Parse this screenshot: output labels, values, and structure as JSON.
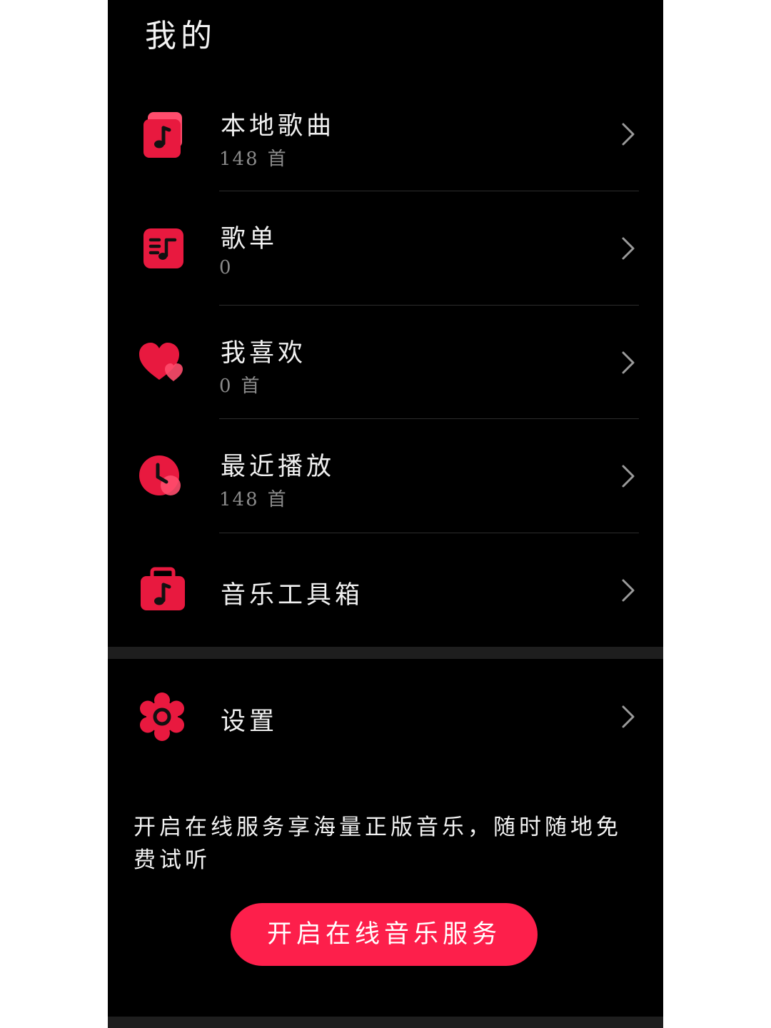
{
  "header": {
    "title": "我的"
  },
  "menu": {
    "items": [
      {
        "id": "local-songs",
        "title": "本地歌曲",
        "count": "148",
        "unit": "首",
        "icon": "music-note-icon"
      },
      {
        "id": "playlists",
        "title": "歌单",
        "count": "0",
        "unit": "",
        "icon": "playlist-icon"
      },
      {
        "id": "favorites",
        "title": "我喜欢",
        "count": "0",
        "unit": "首",
        "icon": "heart-icon"
      },
      {
        "id": "recent",
        "title": "最近播放",
        "count": "148",
        "unit": "首",
        "icon": "clock-icon"
      },
      {
        "id": "toolbox",
        "title": "音乐工具箱",
        "icon": "toolbox-icon"
      }
    ]
  },
  "settings": {
    "title": "设置",
    "icon": "gear-icon"
  },
  "promo": {
    "text": "开启在线服务享海量正版音乐，随时随地免费试听",
    "button_label": "开启在线音乐服务"
  },
  "colors": {
    "accent": "#fd1f4b",
    "icon_red": "#e8193f",
    "icon_red_light": "#ff4d6d",
    "background": "#000000",
    "section_gap": "#1e1e1e",
    "divider": "#2c2c2c",
    "subtext": "#8a8a8a"
  }
}
